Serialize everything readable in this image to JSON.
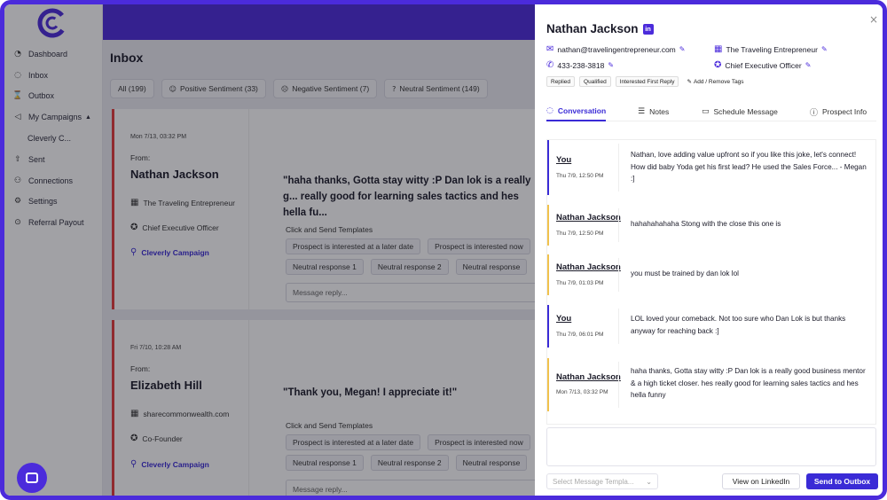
{
  "brand": {
    "accent": "#4b2bdb",
    "alert": "#e33b3b",
    "yellow": "#f1c24d"
  },
  "sidebar": {
    "items": [
      {
        "label": "Dashboard",
        "icon": "dashboard-icon"
      },
      {
        "label": "Inbox",
        "icon": "chat-icon"
      },
      {
        "label": "Outbox",
        "icon": "hourglass-icon"
      },
      {
        "label": "My Campaigns",
        "icon": "megaphone-icon"
      },
      {
        "label": "Cleverly C...",
        "icon": ""
      },
      {
        "label": "Sent",
        "icon": "upload-icon"
      },
      {
        "label": "Connections",
        "icon": "people-icon"
      },
      {
        "label": "Settings",
        "icon": "gear-icon"
      },
      {
        "label": "Referral Payout",
        "icon": "money-icon"
      }
    ]
  },
  "inbox": {
    "title": "Inbox",
    "tabs": [
      "All (199)",
      "Positive Sentiment (33)",
      "Negative Sentiment (7)",
      "Neutral Sentiment (149)"
    ],
    "cards": [
      {
        "date": "Mon 7/13, 03:32 PM",
        "from": "From:",
        "name": "Nathan Jackson",
        "company": "The Traveling Entrepreneur",
        "title": "Chief Executive Officer",
        "campaign": "Cleverly Campaign",
        "quote": "\"haha thanks, Gotta stay witty :P  Dan lok is a really g... really good for learning sales tactics and hes hella fu...",
        "templates_title": "Click and Send Templates",
        "chips_row1": [
          "Prospect is interested at a later date",
          "Prospect is interested now"
        ],
        "chips_row2": [
          "Neutral response 1",
          "Neutral response 2",
          "Neutral response"
        ],
        "reply_placeholder": "Message reply..."
      },
      {
        "date": "Fri 7/10, 10:28 AM",
        "from": "From:",
        "name": "Elizabeth Hill",
        "company": "sharecommonwealth.com",
        "title": "Co-Founder",
        "campaign": "Cleverly Campaign",
        "quote": "\"Thank you, Megan! I appreciate it!\"",
        "templates_title": "Click and Send Templates",
        "chips_row1": [
          "Prospect is interested at a later date",
          "Prospect is interested now"
        ],
        "chips_row2": [
          "Neutral response 1",
          "Neutral response 2",
          "Neutral response"
        ],
        "reply_placeholder": "Message reply..."
      }
    ]
  },
  "drawer": {
    "name": "Nathan Jackson",
    "linkedin_badge": "in",
    "close": "×",
    "email": "nathan@travelingentrepreneur.com",
    "phone": "433-238-3818",
    "company": "The Traveling Entrepreneur",
    "job_title": "Chief Executive Officer",
    "tags": [
      "Replied",
      "Qualified",
      "Interested First Reply"
    ],
    "add_tags": "Add / Remove Tags",
    "tabs": [
      "Conversation",
      "Notes",
      "Schedule Message",
      "Prospect Info"
    ],
    "messages": [
      {
        "who": "You",
        "ts": "Thu 7/9, 12:50 PM",
        "text": "Nathan, love adding value upfront so if you like this joke, let's connect! How did baby Yoda get his first lead? He used the Sales Force... - Megan :]"
      },
      {
        "who": "Nathan Jackson",
        "ts": "Thu 7/9, 12:50 PM",
        "text": "hahahahahaha  Stong with the close this one is"
      },
      {
        "who": "Nathan Jackson",
        "ts": "Thu 7/9, 01:03 PM",
        "text": "you must be trained by dan lok lol"
      },
      {
        "who": "You",
        "ts": "Thu 7/9, 06:01 PM",
        "text": "LOL loved your comeback. Not too sure who Dan Lok is but thanks anyway for reaching back :]"
      },
      {
        "who": "Nathan Jackson",
        "ts": "Mon 7/13, 03:32 PM",
        "text": "haha thanks, Gotta stay witty :P  Dan lok is a really good business mentor & a high ticket closer. hes really good for learning sales tactics and hes hella funny"
      }
    ],
    "template_select_placeholder": "Select Message Templa...",
    "view_linkedin": "View on LinkedIn",
    "send_outbox": "Send to Outbox"
  }
}
